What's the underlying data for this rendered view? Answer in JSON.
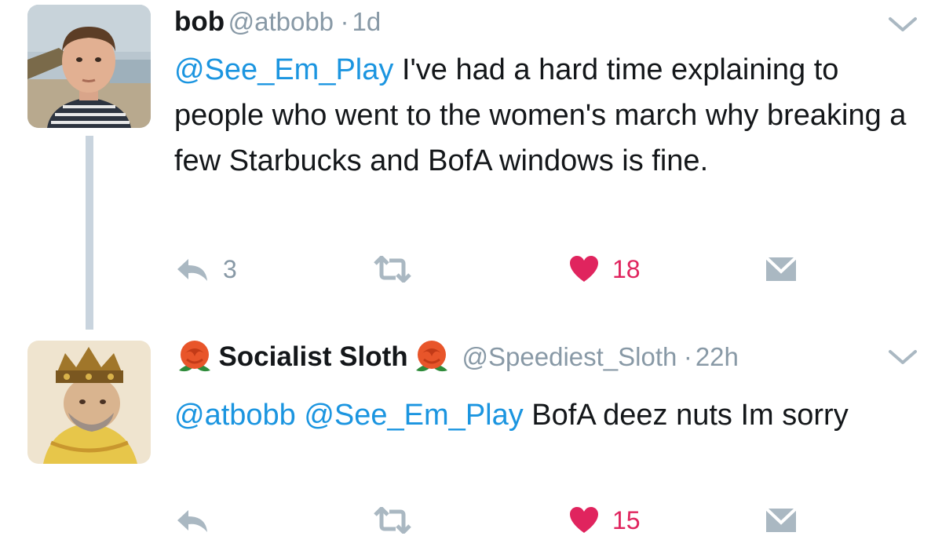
{
  "tweets": [
    {
      "name": "bob",
      "handle": "@atbobb",
      "separator": "·",
      "time": "1d",
      "mentions": "@See_Em_Play",
      "body": " I've had a hard time explaining to people who went to the women's march why breaking a few Starbucks and BofA windows is fine.",
      "reply_count": "3",
      "retweet_count": "",
      "like_count": "18",
      "avatar": "man-beach-photo",
      "colors": {
        "like": "#e0245e",
        "link": "#1b95e0",
        "muted": "#8899a6"
      }
    },
    {
      "name": "Socialist Sloth",
      "handle": "@Speediest_Sloth",
      "separator": "·",
      "time": "22h",
      "mentions": "@atbobb @See_Em_Play",
      "body": " BofA deez nuts Im sorry",
      "reply_count": "",
      "retweet_count": "",
      "like_count": "15",
      "avatar": "crowned-king-painting",
      "name_emoji": "rose-icon"
    }
  ]
}
